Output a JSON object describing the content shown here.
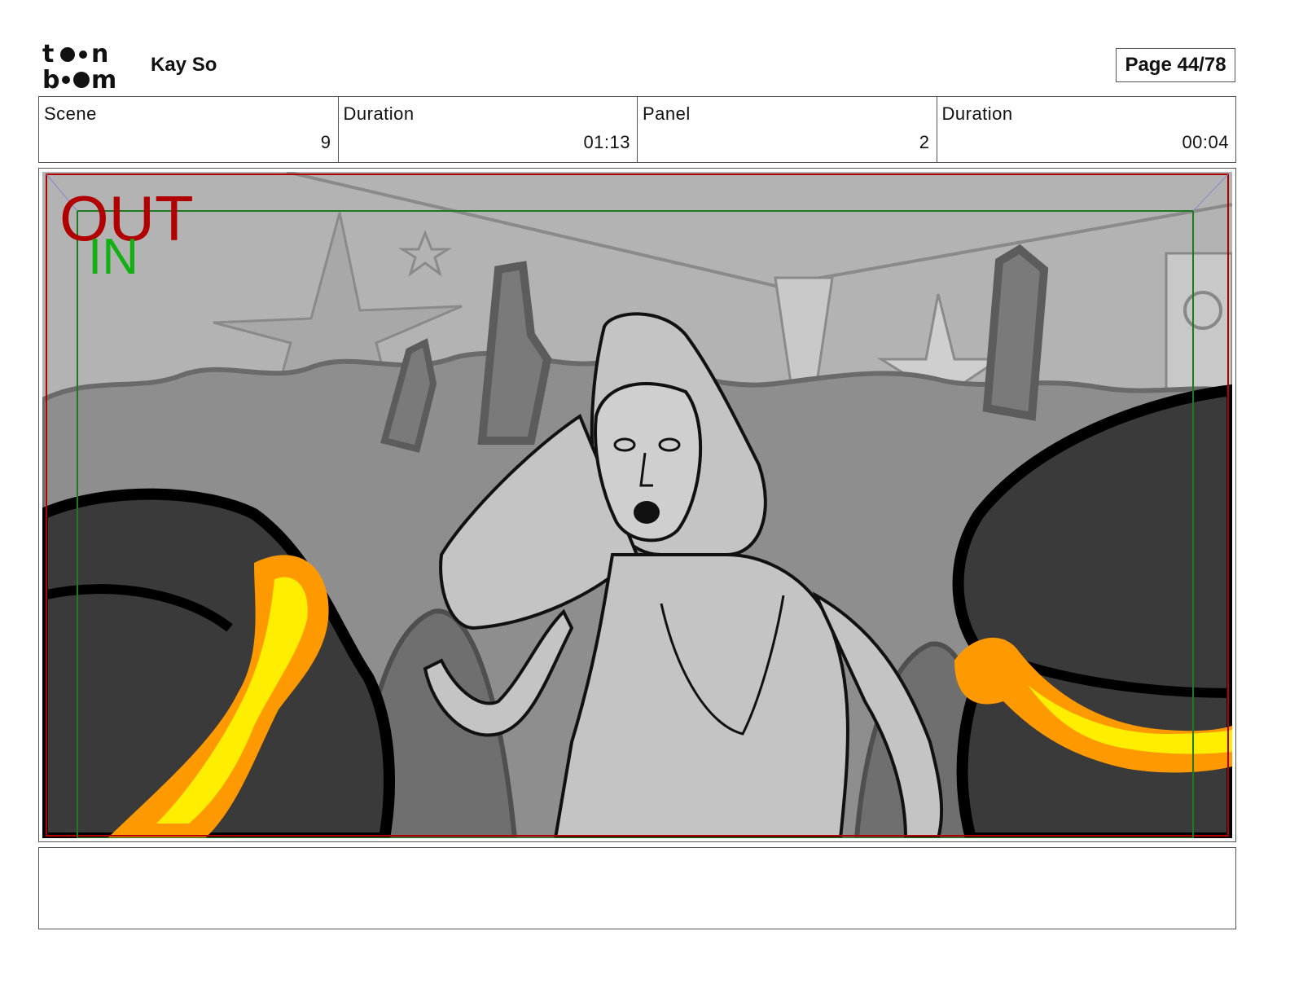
{
  "header": {
    "logo_text": "toon boom",
    "author": "Kay So",
    "page_label": "Page 44/78"
  },
  "info": [
    {
      "label": "Scene",
      "value": "9"
    },
    {
      "label": "Duration",
      "value": "01:13"
    },
    {
      "label": "Panel",
      "value": "2"
    },
    {
      "label": "Duration",
      "value": "00:04"
    }
  ],
  "panel": {
    "safe_out_label": "OUT",
    "safe_in_label": "IN"
  },
  "notes": {
    "text": ""
  },
  "colors": {
    "out_frame": "#b00000",
    "in_frame": "#12b012",
    "highlight_orange": "#ff9900",
    "highlight_yellow": "#ffee00",
    "silhouette": "#3a3a3a"
  }
}
